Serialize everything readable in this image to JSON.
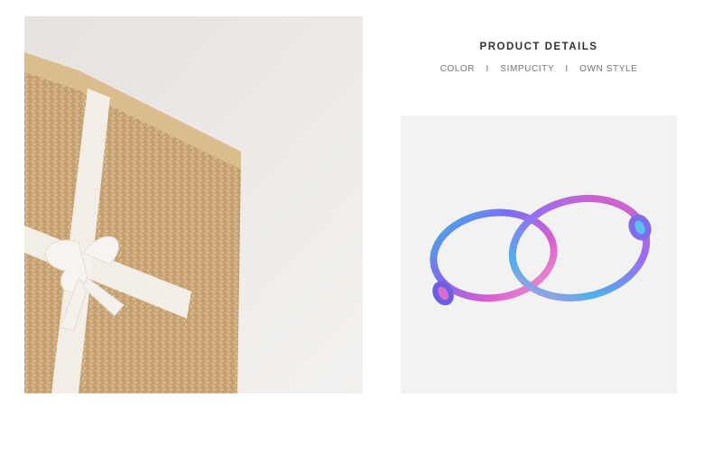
{
  "product_details": {
    "title": "PRODUCT DETAILS",
    "tags": [
      "COLOR",
      "SIMPUCITY",
      "OWN STYLE"
    ],
    "separator": "I"
  },
  "images": {
    "left": {
      "subject": "gold glitter gift box with white ribbon bow"
    },
    "right": {
      "subject": "two rainbow iridescent clip-on hoop earrings"
    }
  },
  "colors": {
    "background": "#ffffff",
    "gift_gold": "#c9a577",
    "ribbon": "#f4f1ec",
    "heading_text": "#333333",
    "subline_text": "#777777",
    "earring_gradient": [
      "#3fb6e8",
      "#7b6cf0",
      "#d85fd0",
      "#f0a0c8"
    ]
  }
}
